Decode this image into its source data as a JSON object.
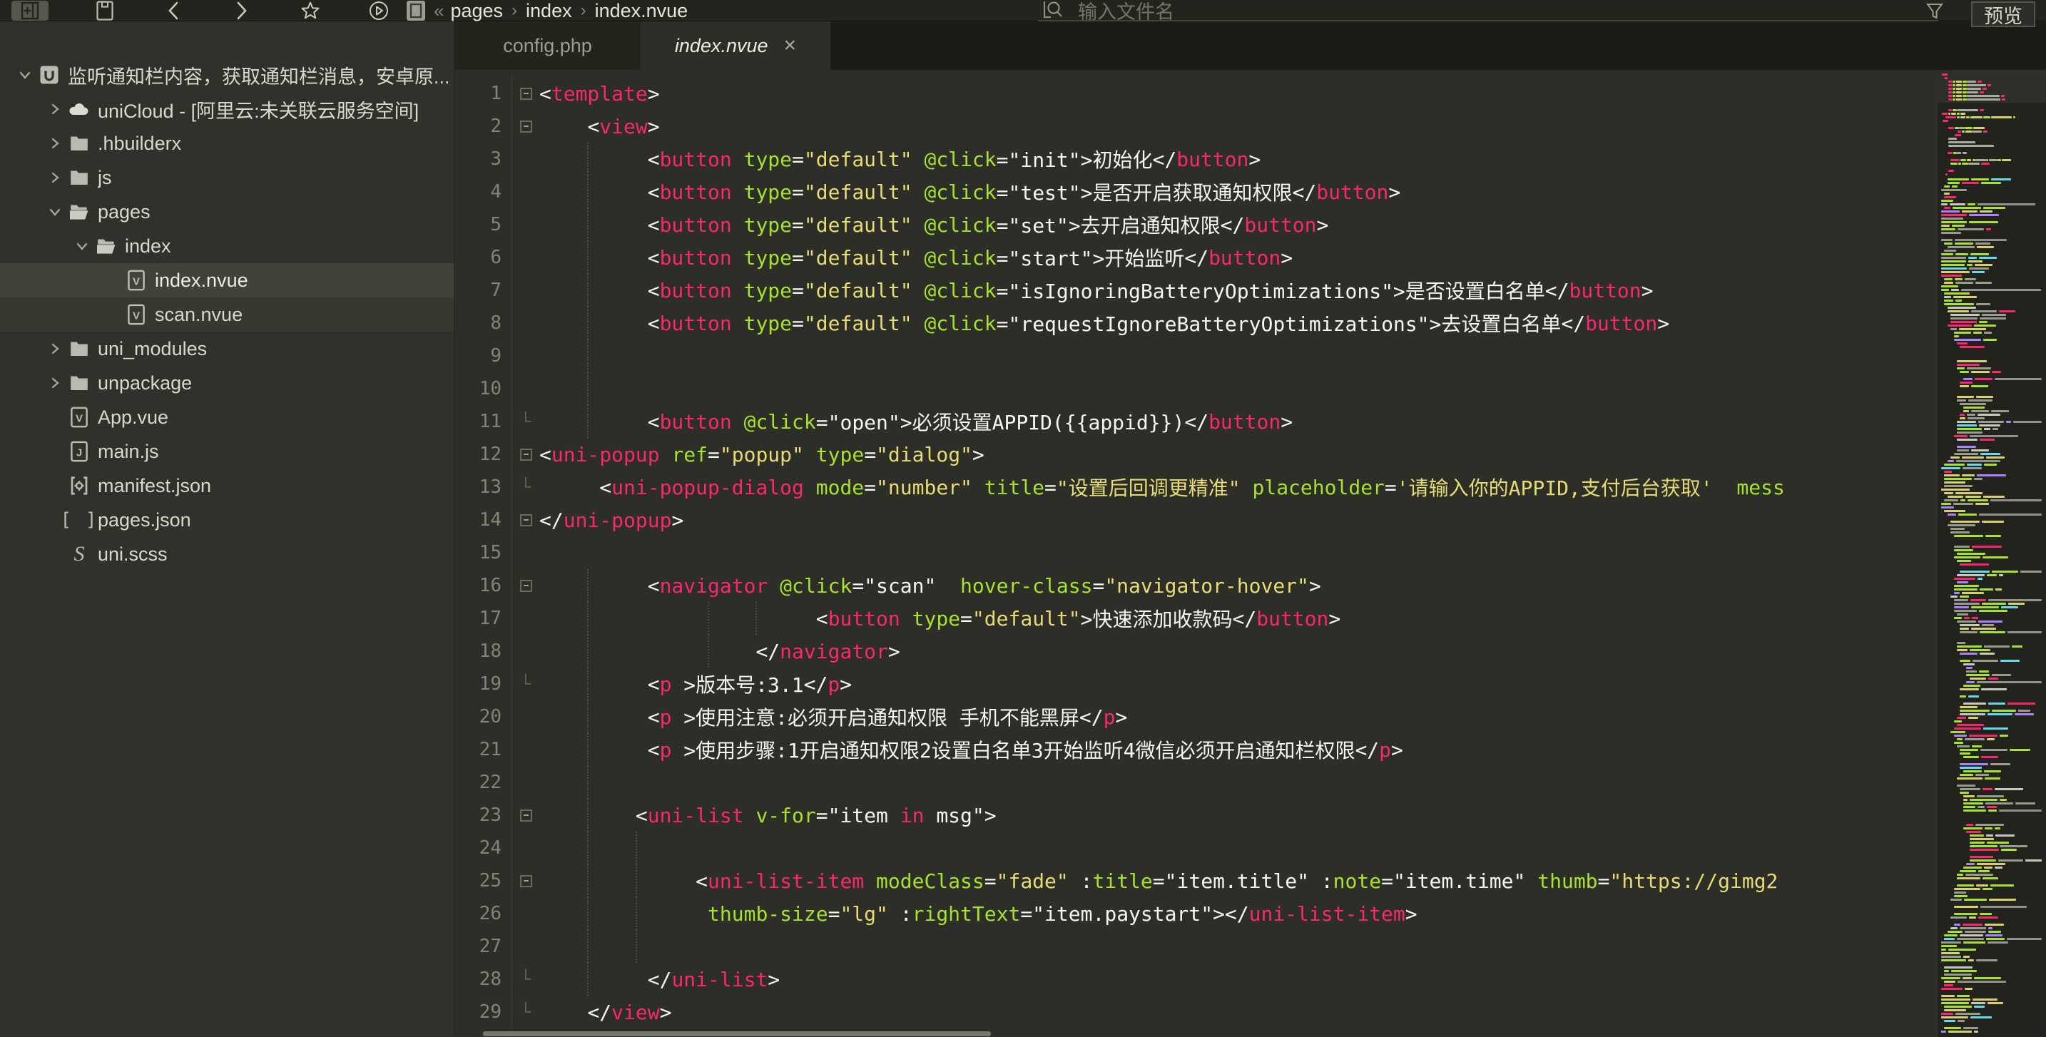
{
  "toolbar": {
    "breadcrumb": [
      "pages",
      "index",
      "index.nvue"
    ],
    "breadcrumb_collapse": "«",
    "search_placeholder": "输入文件名",
    "preview_label": "预览"
  },
  "tabs": [
    {
      "label": "config.php",
      "active": false
    },
    {
      "label": "index.nvue",
      "active": true,
      "close": "×"
    }
  ],
  "sidebar": {
    "items": [
      {
        "label": "监听通知栏内容，获取通知栏消息，安卓原...",
        "level": 0,
        "icon": "app",
        "chevron": "open"
      },
      {
        "label": "uniCloud - [阿里云:未关联云服务空间]",
        "level": 1,
        "icon": "cloud",
        "chevron": "closed"
      },
      {
        "label": ".hbuilderx",
        "level": 1,
        "icon": "folder",
        "chevron": "closed"
      },
      {
        "label": "js",
        "level": 1,
        "icon": "folder",
        "chevron": "closed"
      },
      {
        "label": "pages",
        "level": 1,
        "icon": "folder-open",
        "chevron": "open"
      },
      {
        "label": "index",
        "level": 2,
        "icon": "folder-open",
        "chevron": "open"
      },
      {
        "label": "index.nvue",
        "level": 3,
        "icon": "vue",
        "selected": true
      },
      {
        "label": "scan.nvue",
        "level": 3,
        "icon": "vue",
        "subtle": true
      },
      {
        "label": "uni_modules",
        "level": 1,
        "icon": "folder",
        "chevron": "closed"
      },
      {
        "label": "unpackage",
        "level": 1,
        "icon": "folder",
        "chevron": "closed"
      },
      {
        "label": "App.vue",
        "level": 1,
        "icon": "vue"
      },
      {
        "label": "main.js",
        "level": 1,
        "icon": "js"
      },
      {
        "label": "manifest.json",
        "level": 1,
        "icon": "manifest"
      },
      {
        "label": "pages.json",
        "level": 1,
        "icon": "json"
      },
      {
        "label": "uni.scss",
        "level": 1,
        "icon": "scss"
      }
    ]
  },
  "colors": {
    "tag": "#f92672",
    "attr": "#a6e22e",
    "string": "#e6db74",
    "plain": "#f6f6f0",
    "keyword": "#f92672",
    "minimap_gray": "#9a9b8f",
    "minimap_cyan": "#66d9ef",
    "minimap_purple": "#ae81ff"
  },
  "editor": {
    "lines": [
      {
        "n": 1,
        "indent": 0,
        "fold": "box",
        "guides": [],
        "tok": [
          [
            "w",
            "<"
          ],
          [
            "t",
            "template"
          ],
          [
            "w",
            ">"
          ]
        ]
      },
      {
        "n": 2,
        "indent": 4,
        "fold": "box",
        "guides": [],
        "tok": [
          [
            "w",
            "<"
          ],
          [
            "t",
            "view"
          ],
          [
            "w",
            ">"
          ]
        ]
      },
      {
        "n": 3,
        "indent": 9,
        "fold": "",
        "guides": [
          4
        ],
        "tok": [
          [
            "w",
            "<"
          ],
          [
            "t",
            "button"
          ],
          [
            "w",
            " "
          ],
          [
            "a",
            "type"
          ],
          [
            "w",
            "="
          ],
          [
            "s",
            "\"default\""
          ],
          [
            "w",
            " "
          ],
          [
            "a",
            "@click"
          ],
          [
            "w",
            "=\"init\">初始化"
          ],
          [
            "w",
            "</"
          ],
          [
            "t",
            "button"
          ],
          [
            "w",
            ">"
          ]
        ]
      },
      {
        "n": 4,
        "indent": 9,
        "fold": "",
        "guides": [
          4
        ],
        "tok": [
          [
            "w",
            "<"
          ],
          [
            "t",
            "button"
          ],
          [
            "w",
            " "
          ],
          [
            "a",
            "type"
          ],
          [
            "w",
            "="
          ],
          [
            "s",
            "\"default\""
          ],
          [
            "w",
            " "
          ],
          [
            "a",
            "@click"
          ],
          [
            "w",
            "=\"test\">是否开启获取通知权限"
          ],
          [
            "w",
            "</"
          ],
          [
            "t",
            "button"
          ],
          [
            "w",
            ">"
          ]
        ]
      },
      {
        "n": 5,
        "indent": 9,
        "fold": "",
        "guides": [
          4
        ],
        "tok": [
          [
            "w",
            "<"
          ],
          [
            "t",
            "button"
          ],
          [
            "w",
            " "
          ],
          [
            "a",
            "type"
          ],
          [
            "w",
            "="
          ],
          [
            "s",
            "\"default\""
          ],
          [
            "w",
            " "
          ],
          [
            "a",
            "@click"
          ],
          [
            "w",
            "=\"set\">去开启通知权限"
          ],
          [
            "w",
            "</"
          ],
          [
            "t",
            "button"
          ],
          [
            "w",
            ">"
          ]
        ]
      },
      {
        "n": 6,
        "indent": 9,
        "fold": "",
        "guides": [
          4
        ],
        "tok": [
          [
            "w",
            "<"
          ],
          [
            "t",
            "button"
          ],
          [
            "w",
            " "
          ],
          [
            "a",
            "type"
          ],
          [
            "w",
            "="
          ],
          [
            "s",
            "\"default\""
          ],
          [
            "w",
            " "
          ],
          [
            "a",
            "@click"
          ],
          [
            "w",
            "=\"start\">开始监听"
          ],
          [
            "w",
            "</"
          ],
          [
            "t",
            "button"
          ],
          [
            "w",
            ">"
          ]
        ]
      },
      {
        "n": 7,
        "indent": 9,
        "fold": "",
        "guides": [
          4
        ],
        "tok": [
          [
            "w",
            "<"
          ],
          [
            "t",
            "button"
          ],
          [
            "w",
            " "
          ],
          [
            "a",
            "type"
          ],
          [
            "w",
            "="
          ],
          [
            "s",
            "\"default\""
          ],
          [
            "w",
            " "
          ],
          [
            "a",
            "@click"
          ],
          [
            "w",
            "=\"isIgnoringBatteryOptimizations\">是否设置白名单"
          ],
          [
            "w",
            "</"
          ],
          [
            "t",
            "button"
          ],
          [
            "w",
            ">"
          ]
        ]
      },
      {
        "n": 8,
        "indent": 9,
        "fold": "",
        "guides": [
          4
        ],
        "tok": [
          [
            "w",
            "<"
          ],
          [
            "t",
            "button"
          ],
          [
            "w",
            " "
          ],
          [
            "a",
            "type"
          ],
          [
            "w",
            "="
          ],
          [
            "s",
            "\"default\""
          ],
          [
            "w",
            " "
          ],
          [
            "a",
            "@click"
          ],
          [
            "w",
            "=\"requestIgnoreBatteryOptimizations\">去设置白名单"
          ],
          [
            "w",
            "</"
          ],
          [
            "t",
            "button"
          ],
          [
            "w",
            ">"
          ]
        ]
      },
      {
        "n": 9,
        "indent": 0,
        "fold": "",
        "guides": [
          4
        ],
        "tok": []
      },
      {
        "n": 10,
        "indent": 0,
        "fold": "",
        "guides": [
          4
        ],
        "tok": []
      },
      {
        "n": 11,
        "indent": 9,
        "fold": "end",
        "guides": [
          4
        ],
        "tok": [
          [
            "w",
            "<"
          ],
          [
            "t",
            "button"
          ],
          [
            "w",
            " "
          ],
          [
            "a",
            "@click"
          ],
          [
            "w",
            "=\"open\">必须设置APPID({{appid}})"
          ],
          [
            "w",
            "</"
          ],
          [
            "t",
            "button"
          ],
          [
            "w",
            ">"
          ]
        ]
      },
      {
        "n": 12,
        "indent": 0,
        "fold": "box",
        "guides": [],
        "tok": [
          [
            "w",
            "<"
          ],
          [
            "t",
            "uni-popup"
          ],
          [
            "w",
            " "
          ],
          [
            "a",
            "ref"
          ],
          [
            "w",
            "="
          ],
          [
            "s",
            "\"popup\""
          ],
          [
            "w",
            " "
          ],
          [
            "a",
            "type"
          ],
          [
            "w",
            "="
          ],
          [
            "s",
            "\"dialog\""
          ],
          [
            "w",
            ">"
          ]
        ]
      },
      {
        "n": 13,
        "indent": 5,
        "fold": "end",
        "guides": [],
        "tok": [
          [
            "w",
            "<"
          ],
          [
            "t",
            "uni-popup-dialog"
          ],
          [
            "w",
            " "
          ],
          [
            "a",
            "mode"
          ],
          [
            "w",
            "="
          ],
          [
            "s",
            "\"number\""
          ],
          [
            "w",
            " "
          ],
          [
            "a",
            "title"
          ],
          [
            "w",
            "="
          ],
          [
            "s",
            "\"设置后回调更精准\""
          ],
          [
            "w",
            " "
          ],
          [
            "a",
            "placeholder"
          ],
          [
            "w",
            "="
          ],
          [
            "s",
            "'请输入你的APPID,支付后台获取'"
          ],
          [
            "w",
            "  "
          ],
          [
            "a",
            "mess"
          ]
        ]
      },
      {
        "n": 14,
        "indent": 0,
        "fold": "box",
        "guides": [],
        "tok": [
          [
            "w",
            "</"
          ],
          [
            "t",
            "uni-popup"
          ],
          [
            "w",
            ">"
          ]
        ]
      },
      {
        "n": 15,
        "indent": 0,
        "fold": "",
        "guides": [],
        "tok": []
      },
      {
        "n": 16,
        "indent": 9,
        "fold": "box",
        "guides": [
          4
        ],
        "tok": [
          [
            "w",
            "<"
          ],
          [
            "t",
            "navigator"
          ],
          [
            "w",
            " "
          ],
          [
            "a",
            "@click"
          ],
          [
            "w",
            "=\"scan\"  "
          ],
          [
            "a",
            "hover-class"
          ],
          [
            "w",
            "="
          ],
          [
            "s",
            "\"navigator-hover\""
          ],
          [
            "w",
            ">"
          ]
        ]
      },
      {
        "n": 17,
        "indent": 23,
        "fold": "",
        "guides": [
          4,
          14,
          18
        ],
        "tok": [
          [
            "w",
            "<"
          ],
          [
            "t",
            "button"
          ],
          [
            "w",
            " "
          ],
          [
            "a",
            "type"
          ],
          [
            "w",
            "="
          ],
          [
            "s",
            "\"default\""
          ],
          [
            "w",
            ">快速添加收款码"
          ],
          [
            "w",
            "</"
          ],
          [
            "t",
            "button"
          ],
          [
            "w",
            ">"
          ]
        ]
      },
      {
        "n": 18,
        "indent": 18,
        "fold": "",
        "guides": [
          4,
          14
        ],
        "tok": [
          [
            "w",
            "</"
          ],
          [
            "t",
            "navigator"
          ],
          [
            "w",
            ">"
          ]
        ]
      },
      {
        "n": 19,
        "indent": 9,
        "fold": "end",
        "guides": [
          4
        ],
        "tok": [
          [
            "w",
            "<"
          ],
          [
            "t",
            "p"
          ],
          [
            "w",
            " >版本号:3.1"
          ],
          [
            "w",
            "</"
          ],
          [
            "t",
            "p"
          ],
          [
            "w",
            ">"
          ]
        ]
      },
      {
        "n": 20,
        "indent": 9,
        "fold": "",
        "guides": [
          4
        ],
        "tok": [
          [
            "w",
            "<"
          ],
          [
            "t",
            "p"
          ],
          [
            "w",
            " >使用注意:必须开启通知权限 手机不能黑屏"
          ],
          [
            "w",
            "</"
          ],
          [
            "t",
            "p"
          ],
          [
            "w",
            ">"
          ]
        ]
      },
      {
        "n": 21,
        "indent": 9,
        "fold": "",
        "guides": [
          4
        ],
        "tok": [
          [
            "w",
            "<"
          ],
          [
            "t",
            "p"
          ],
          [
            "w",
            " >使用步骤:1开启通知权限2设置白名单3开始监听4微信必须开启通知栏权限"
          ],
          [
            "w",
            "</"
          ],
          [
            "t",
            "p"
          ],
          [
            "w",
            ">"
          ]
        ]
      },
      {
        "n": 22,
        "indent": 0,
        "fold": "",
        "guides": [
          4
        ],
        "tok": []
      },
      {
        "n": 23,
        "indent": 8,
        "fold": "box",
        "guides": [
          4
        ],
        "tok": [
          [
            "w",
            "<"
          ],
          [
            "t",
            "uni-list"
          ],
          [
            "w",
            " "
          ],
          [
            "a",
            "v-for"
          ],
          [
            "w",
            "=\"item "
          ],
          [
            "k",
            "in"
          ],
          [
            "w",
            " msg\">"
          ]
        ]
      },
      {
        "n": 24,
        "indent": 0,
        "fold": "",
        "guides": [
          4,
          8
        ],
        "tok": []
      },
      {
        "n": 25,
        "indent": 13,
        "fold": "box",
        "guides": [
          4,
          8
        ],
        "tok": [
          [
            "w",
            "<"
          ],
          [
            "t",
            "uni-list-item"
          ],
          [
            "w",
            " "
          ],
          [
            "a",
            "modeClass"
          ],
          [
            "w",
            "="
          ],
          [
            "s",
            "\"fade\""
          ],
          [
            "w",
            " :"
          ],
          [
            "a",
            "title"
          ],
          [
            "w",
            "=\"item.title\" :"
          ],
          [
            "a",
            "note"
          ],
          [
            "w",
            "=\"item.time\" "
          ],
          [
            "a",
            "thumb"
          ],
          [
            "w",
            "="
          ],
          [
            "s",
            "\"https://gimg2"
          ]
        ]
      },
      {
        "n": 26,
        "indent": 14,
        "fold": "",
        "guides": [
          4,
          8
        ],
        "tok": [
          [
            "a",
            "thumb-size"
          ],
          [
            "w",
            "="
          ],
          [
            "s",
            "\"lg\""
          ],
          [
            "w",
            " :"
          ],
          [
            "a",
            "rightText"
          ],
          [
            "w",
            "=\"item.paystart\">"
          ],
          [
            "w",
            "</"
          ],
          [
            "t",
            "uni-list-item"
          ],
          [
            "w",
            ">"
          ]
        ]
      },
      {
        "n": 27,
        "indent": 0,
        "fold": "",
        "guides": [
          4,
          8
        ],
        "tok": []
      },
      {
        "n": 28,
        "indent": 9,
        "fold": "end",
        "guides": [
          4
        ],
        "tok": [
          [
            "w",
            "</"
          ],
          [
            "t",
            "uni-list"
          ],
          [
            "w",
            ">"
          ]
        ]
      },
      {
        "n": 29,
        "indent": 4,
        "fold": "end",
        "guides": [],
        "tok": [
          [
            "w",
            "</"
          ],
          [
            "t",
            "view"
          ],
          [
            "w",
            ">"
          ]
        ]
      }
    ]
  }
}
